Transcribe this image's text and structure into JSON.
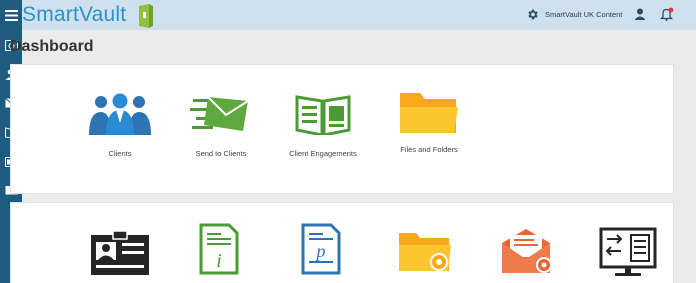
{
  "app": {
    "brand": "SmartVault",
    "account_name": "SmartVault UK Content"
  },
  "icons": {
    "sidebar": [
      "menu-icon",
      "dashboard-icon",
      "contacts-icon",
      "mail-icon",
      "engagement-book-icon",
      "id-card-icon",
      "folder-icon"
    ],
    "header": [
      "gear-icon",
      "user-icon",
      "bell-icon"
    ]
  },
  "colors": {
    "sidebar": "#1d5c7e",
    "header": "#cfe0ee",
    "brand_blue": "#2a93c9",
    "green": "#4c9a36",
    "folder_yellow": "#f9b716",
    "orange": "#e8653a",
    "notification": "#e53935"
  },
  "page": {
    "title": "Dashboard"
  },
  "quick_actions": [
    {
      "label": "Clients",
      "icon": "clients-icon"
    },
    {
      "label": "Send to Clients",
      "icon": "send-envelope-icon"
    },
    {
      "label": "Client Engagements",
      "icon": "engagement-book-icon"
    },
    {
      "label": "Files and Folders",
      "icon": "folder-icon"
    }
  ],
  "more_actions": [
    {
      "icon": "id-card-icon"
    },
    {
      "icon": "info-document-icon"
    },
    {
      "icon": "document-p-icon"
    },
    {
      "icon": "folder-settings-icon"
    },
    {
      "icon": "envelope-settings-icon"
    },
    {
      "icon": "monitor-transfer-icon"
    }
  ]
}
